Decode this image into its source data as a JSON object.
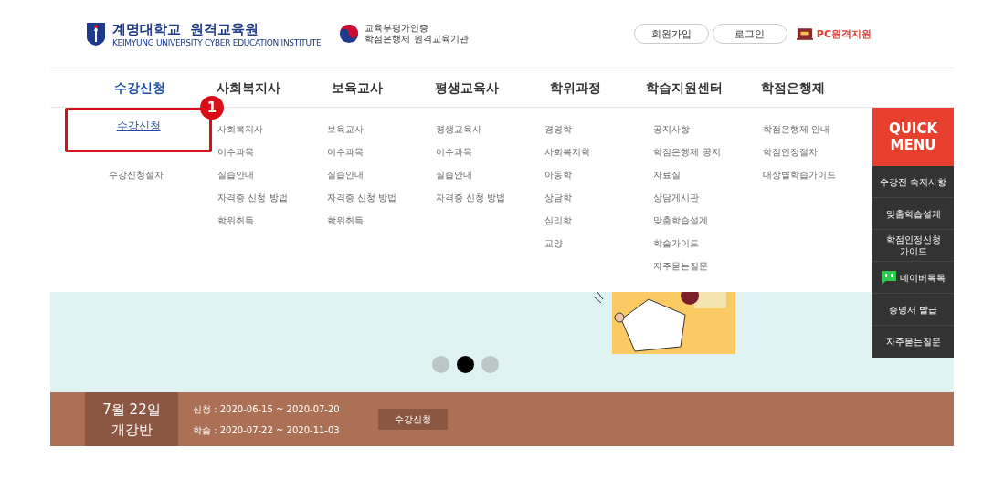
{
  "header": {
    "logo_title": "계명대학교  원격교육원",
    "logo_subtitle": "KEIMYUNG UNIVERSITY CYBER EDUCATION  INSTITUTE",
    "cert_lines": [
      "교육부평가인증",
      "학점은행제 원격교육기관"
    ],
    "buttons": [
      "회원가입",
      "로그인"
    ],
    "pc_support": "PC원격지원"
  },
  "nav": [
    {
      "label": "수강신청",
      "selected": true,
      "items": [
        {
          "label": "수강신청",
          "highlighted": true
        },
        {
          "label": "수강신청절차",
          "highlighted": false
        }
      ]
    },
    {
      "label": "사회복지사",
      "selected": false,
      "items": [
        {
          "label": "사회복지사",
          "highlighted": false
        },
        {
          "label": "이수과목",
          "highlighted": false
        },
        {
          "label": "실습안내",
          "highlighted": false
        },
        {
          "label": "자격증 신청 방법",
          "highlighted": false
        },
        {
          "label": "학위취득",
          "highlighted": false
        }
      ]
    },
    {
      "label": "보육교사",
      "selected": false,
      "items": [
        {
          "label": "보육교사",
          "highlighted": false
        },
        {
          "label": "이수과목",
          "highlighted": false
        },
        {
          "label": "실습안내",
          "highlighted": false
        },
        {
          "label": "자격증 신청 방법",
          "highlighted": false
        },
        {
          "label": "학위취득",
          "highlighted": false
        }
      ]
    },
    {
      "label": "평생교육사",
      "selected": false,
      "items": [
        {
          "label": "평생교육사",
          "highlighted": false
        },
        {
          "label": "이수과목",
          "highlighted": false
        },
        {
          "label": "실습안내",
          "highlighted": false
        },
        {
          "label": "자격증 신청 방법",
          "highlighted": false
        }
      ]
    },
    {
      "label": "학위과정",
      "selected": false,
      "items": [
        {
          "label": "경영학",
          "highlighted": false
        },
        {
          "label": "사회복지학",
          "highlighted": false
        },
        {
          "label": "아동학",
          "highlighted": false
        },
        {
          "label": "상담학",
          "highlighted": false
        },
        {
          "label": "심리학",
          "highlighted": false
        },
        {
          "label": "교양",
          "highlighted": false
        }
      ]
    },
    {
      "label": "학습지원센터",
      "selected": false,
      "items": [
        {
          "label": "공지사항",
          "highlighted": false
        },
        {
          "label": "학점은행제 공지",
          "highlighted": false
        },
        {
          "label": "자료실",
          "highlighted": false
        },
        {
          "label": "상담게시판",
          "highlighted": false
        },
        {
          "label": "맞춤학습설계",
          "highlighted": false
        },
        {
          "label": "학습가이드",
          "highlighted": false
        },
        {
          "label": "자주묻는질문",
          "highlighted": false
        }
      ]
    },
    {
      "label": "학점은행제",
      "selected": false,
      "items": [
        {
          "label": "학점은행제 안내",
          "highlighted": false
        },
        {
          "label": "학점인정절차",
          "highlighted": false
        },
        {
          "label": "대상별학습가이드",
          "highlighted": false
        }
      ]
    }
  ],
  "annotation": {
    "label": "1"
  },
  "quick_menu": {
    "title": [
      "QUICK",
      "MENU"
    ],
    "items": [
      {
        "label": "수강전 숙지사항",
        "kind": "text"
      },
      {
        "label": "맞춤학습설계",
        "kind": "text"
      },
      {
        "label": "학점인정신청\n가이드",
        "kind": "text"
      },
      {
        "label": "네이버톡톡",
        "kind": "talk"
      },
      {
        "label": "증명서 발급",
        "kind": "text"
      },
      {
        "label": "자주묻는질문",
        "kind": "text"
      }
    ]
  },
  "slider": {
    "dots": [
      {
        "selected": false
      },
      {
        "selected": true
      },
      {
        "selected": false
      }
    ]
  },
  "course_bar": {
    "date": "7월 22일",
    "title": "개강반",
    "lines": [
      "신청 : 2020-06-15 ~ 2020-07-20",
      "학습 : 2020-07-22 ~ 2020-11-03"
    ],
    "button": "수강신청"
  }
}
